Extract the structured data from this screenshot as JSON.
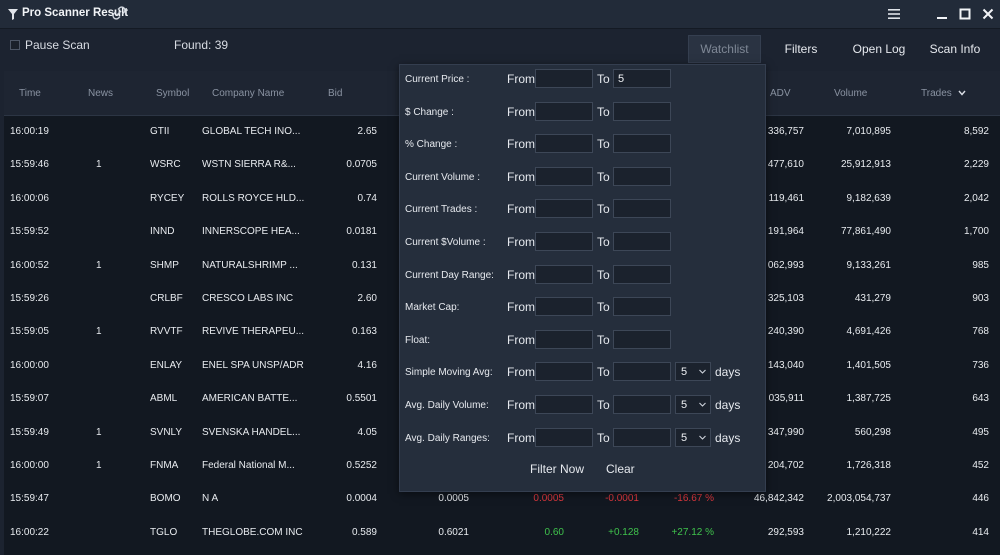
{
  "window": {
    "title": "Pro Scanner Result"
  },
  "toolbar": {
    "pause_label": "Pause Scan",
    "found_label": "Found: 39",
    "buttons": [
      "Watchlist",
      "Filters",
      "Open Log",
      "Scan Info"
    ]
  },
  "grid": {
    "headers": [
      "Time",
      "News",
      "Symbol",
      "Company Name",
      "Bid",
      "ADV",
      "Volume",
      "Trades"
    ],
    "rows": [
      {
        "time": "16:00:19",
        "news": "",
        "symbol": "GTII",
        "company": "GLOBAL TECH INO...",
        "bid": "2.65",
        "adv": "336,757",
        "volume": "7,010,895",
        "trades": "8,592"
      },
      {
        "time": "15:59:46",
        "news": "1",
        "symbol": "WSRC",
        "company": "WSTN SIERRA R&...",
        "bid": "0.0705",
        "adv": "477,610",
        "volume": "25,912,913",
        "trades": "2,229"
      },
      {
        "time": "16:00:06",
        "news": "",
        "symbol": "RYCEY",
        "company": "ROLLS ROYCE HLD...",
        "bid": "0.74",
        "adv": "119,461",
        "volume": "9,182,639",
        "trades": "2,042"
      },
      {
        "time": "15:59:52",
        "news": "",
        "symbol": "INND",
        "company": "INNERSCOPE HEA...",
        "bid": "0.0181",
        "adv": "191,964",
        "volume": "77,861,490",
        "trades": "1,700"
      },
      {
        "time": "16:00:52",
        "news": "1",
        "symbol": "SHMP",
        "company": "NATURALSHRIMP ...",
        "bid": "0.131",
        "adv": "062,993",
        "volume": "9,133,261",
        "trades": "985"
      },
      {
        "time": "15:59:26",
        "news": "",
        "symbol": "CRLBF",
        "company": "CRESCO LABS INC",
        "bid": "2.60",
        "adv": "325,103",
        "volume": "431,279",
        "trades": "903"
      },
      {
        "time": "15:59:05",
        "news": "1",
        "symbol": "RVVTF",
        "company": "REVIVE THERAPEU...",
        "bid": "0.163",
        "adv": "240,390",
        "volume": "4,691,426",
        "trades": "768"
      },
      {
        "time": "16:00:00",
        "news": "",
        "symbol": "ENLAY",
        "company": "ENEL SPA UNSP/ADR",
        "bid": "4.16",
        "adv": "143,040",
        "volume": "1,401,505",
        "trades": "736"
      },
      {
        "time": "15:59:07",
        "news": "",
        "symbol": "ABML",
        "company": "AMERICAN BATTE...",
        "bid": "0.5501",
        "adv": "035,911",
        "volume": "1,387,725",
        "trades": "643"
      },
      {
        "time": "15:59:49",
        "news": "1",
        "symbol": "SVNLY",
        "company": "SVENSKA HANDEL...",
        "bid": "4.05",
        "adv": "347,990",
        "volume": "560,298",
        "trades": "495"
      },
      {
        "time": "16:00:00",
        "news": "1",
        "symbol": "FNMA",
        "company": "Federal National M...",
        "bid": "0.5252",
        "adv": "204,702",
        "volume": "1,726,318",
        "trades": "452"
      },
      {
        "time": "15:59:47",
        "news": "",
        "symbol": "BOMO",
        "company": "N A",
        "bid": "0.0004",
        "ask": "0.0005",
        "last": "0.0005",
        "change": "-0.0001",
        "pct": "-16.67 %",
        "adv": "46,842,342",
        "volume": "2,003,054,737",
        "trades": "446"
      },
      {
        "time": "16:00:22",
        "news": "",
        "symbol": "TGLO",
        "company": "THEGLOBE.COM INC",
        "bid": "0.589",
        "ask": "0.6021",
        "last": "0.60",
        "change": "+0.128",
        "pct": "+27.12 %",
        "adv": "292,593",
        "volume": "1,210,222",
        "trades": "414"
      }
    ]
  },
  "filters": {
    "from_label": "From",
    "to_label": "To",
    "days_label": "days",
    "rows": [
      {
        "label": "Current Price :",
        "from": "",
        "to": "5"
      },
      {
        "label": "$ Change :",
        "from": "",
        "to": ""
      },
      {
        "label": "% Change :",
        "from": "",
        "to": ""
      },
      {
        "label": "Current Volume :",
        "from": "",
        "to": ""
      },
      {
        "label": "Current Trades :",
        "from": "",
        "to": ""
      },
      {
        "label": "Current $Volume :",
        "from": "",
        "to": ""
      },
      {
        "label": "Current Day Range:",
        "from": "",
        "to": ""
      },
      {
        "label": "Market Cap:",
        "from": "",
        "to": ""
      },
      {
        "label": "Float:",
        "from": "",
        "to": ""
      },
      {
        "label": "Simple Moving Avg:",
        "from": "",
        "to": "",
        "days": "5"
      },
      {
        "label": "Avg. Daily Volume:",
        "from": "",
        "to": "",
        "days": "5"
      },
      {
        "label": "Avg. Daily Ranges:",
        "from": "",
        "to": "",
        "days": "5"
      }
    ],
    "filter_now_label": "Filter Now",
    "clear_label": "Clear"
  },
  "colors": {
    "negative": "#e0383e",
    "positive": "#3fc24c"
  }
}
